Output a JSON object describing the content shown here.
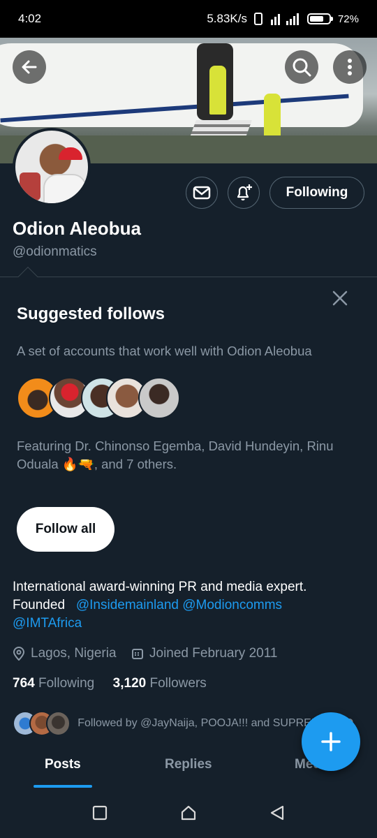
{
  "status_bar": {
    "time": "4:02",
    "net_speed": "5.83K/s",
    "battery": "72%"
  },
  "profile": {
    "name": "Odion Aleobua",
    "handle": "@odionmatics",
    "following_button": "Following"
  },
  "suggested": {
    "title": "Suggested follows",
    "subtitle": "A set of accounts that work well with Odion Aleobua",
    "featuring": "Featuring Dr. Chinonso Egemba, David Hundeyin, Rinu Oduala 🔥🔫, and 7 others.",
    "follow_all": "Follow all"
  },
  "bio": {
    "line1": "International award-winning PR and media expert.",
    "founded": "Founded",
    "link1": "@Insidemainland",
    "link2": "@Modioncomms",
    "link3": "@IMTAfrica"
  },
  "meta": {
    "location": "Lagos, Nigeria",
    "joined": "Joined February 2011"
  },
  "stats": {
    "following_count": "764",
    "following_label": "Following",
    "followers_count": "3,120",
    "followers_label": "Followers"
  },
  "followed_by": "Followed by @JayNaija, POOJA!!! and SUPREME LEO",
  "tabs": [
    "Posts",
    "Replies",
    "Media"
  ],
  "colors": {
    "accent": "#1d9bf0",
    "background": "#15202b",
    "muted": "#8b98a5"
  }
}
